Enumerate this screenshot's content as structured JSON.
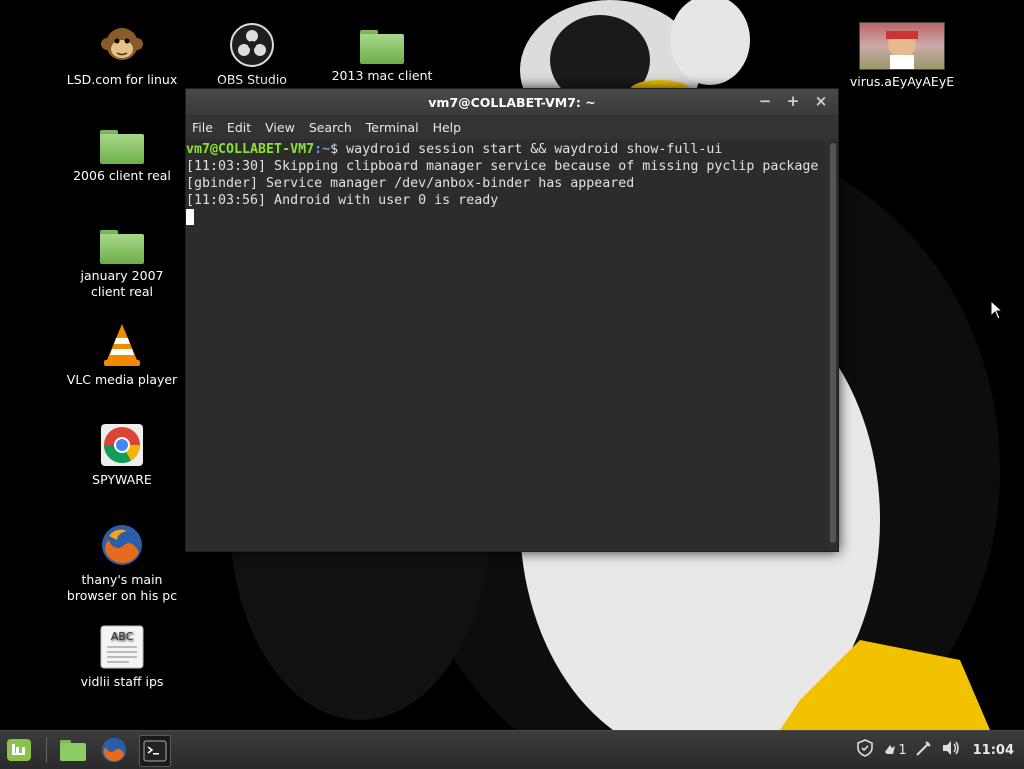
{
  "desktop": {
    "icons": [
      {
        "label": "LSD.com for linux",
        "icon": "monkey-icon"
      },
      {
        "label": "OBS Studio",
        "icon": "obs-icon"
      },
      {
        "label": "2013 mac client",
        "icon": "folder-icon"
      },
      {
        "label": "virus.aEyAyAEyE",
        "icon": "image-thumbnail-icon"
      },
      {
        "label": "2006 client real",
        "icon": "folder-icon"
      },
      {
        "label": "january 2007 client real",
        "icon": "folder-icon"
      },
      {
        "label": "VLC media player",
        "icon": "vlc-icon"
      },
      {
        "label": "SPYWARE",
        "icon": "chrome-icon"
      },
      {
        "label": "thany's main browser on his pc",
        "icon": "firefox-icon"
      },
      {
        "label": "vidlii staff ips",
        "icon": "text-file-icon"
      }
    ]
  },
  "terminal": {
    "title": "vm7@COLLABET-VM7: ~",
    "menu": [
      "File",
      "Edit",
      "View",
      "Search",
      "Terminal",
      "Help"
    ],
    "prompt_user": "vm7@COLLABET-VM7",
    "prompt_path": ":~",
    "prompt_symbol": "$ ",
    "command": "waydroid session start && waydroid show-full-ui",
    "output": [
      "[11:03:30] Skipping clipboard manager service because of missing pyclip package",
      "[gbinder] Service manager /dev/anbox-binder has appeared",
      "[11:03:56] Android with user 0 is ready"
    ],
    "window_buttons": {
      "minimize": "−",
      "maximize": "+",
      "close": "×"
    }
  },
  "taskbar": {
    "menu_icon": "mint-menu-icon",
    "launchers": [
      "files-icon",
      "firefox-icon",
      "terminal-icon"
    ],
    "tray": {
      "update_badge": "1",
      "clock": "11:04"
    }
  }
}
